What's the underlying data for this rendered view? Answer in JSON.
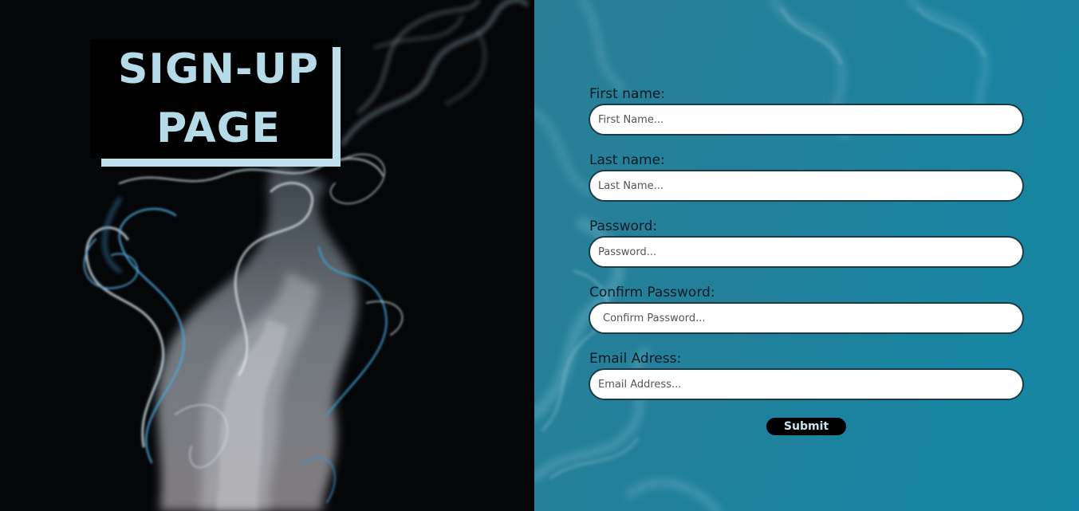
{
  "hero": {
    "title_line1": "SIGN-UP",
    "title_line2": "PAGE"
  },
  "form": {
    "first_name": {
      "label": "First name:",
      "placeholder": "First Name..."
    },
    "last_name": {
      "label": "Last name:",
      "placeholder": "Last Name..."
    },
    "password": {
      "label": "Password:",
      "placeholder": "Password..."
    },
    "confirm_password": {
      "label": "Confirm Password:",
      "placeholder": "Confirm Password..."
    },
    "email": {
      "label": "Email Adress:",
      "placeholder": "Email Address..."
    },
    "submit_label": "Submit"
  },
  "colors": {
    "title_text": "#b6dbe8",
    "title_bg": "#000000",
    "right_panel": "#1a84a0",
    "submit_bg": "#000000"
  }
}
